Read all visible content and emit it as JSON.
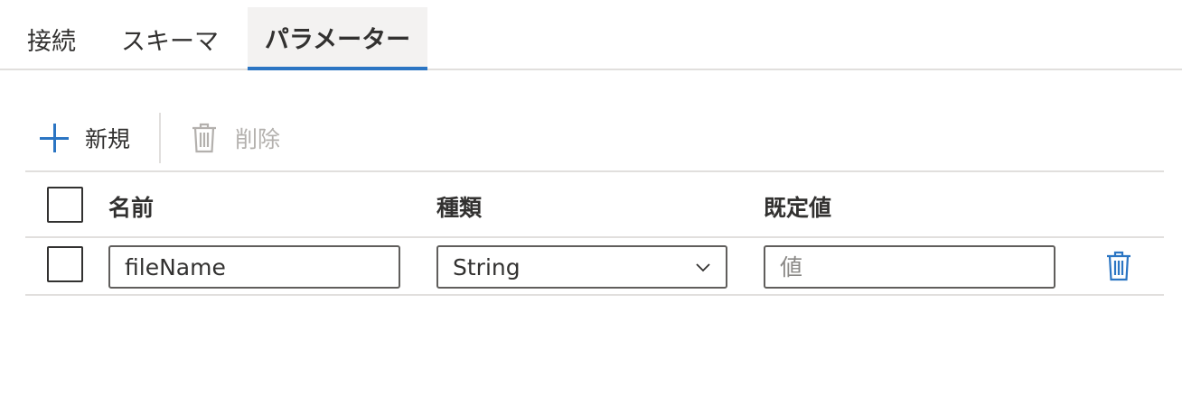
{
  "tabs": [
    {
      "label": "接続",
      "active": false
    },
    {
      "label": "スキーマ",
      "active": false
    },
    {
      "label": "パラメーター",
      "active": true
    }
  ],
  "toolbar": {
    "new_label": "新規",
    "delete_label": "削除",
    "delete_enabled": false
  },
  "grid": {
    "headers": {
      "name": "名前",
      "type": "種類",
      "default": "既定値"
    },
    "rows": [
      {
        "name": "fileName",
        "type": "String",
        "default_value": "",
        "default_placeholder": "値"
      }
    ]
  },
  "colors": {
    "accent": "#2b75c3",
    "border": "#e1dfdd",
    "text": "#323130",
    "disabled": "#b3b0ad"
  },
  "icons": [
    "plus-icon",
    "trash-icon",
    "chevron-down-icon"
  ]
}
